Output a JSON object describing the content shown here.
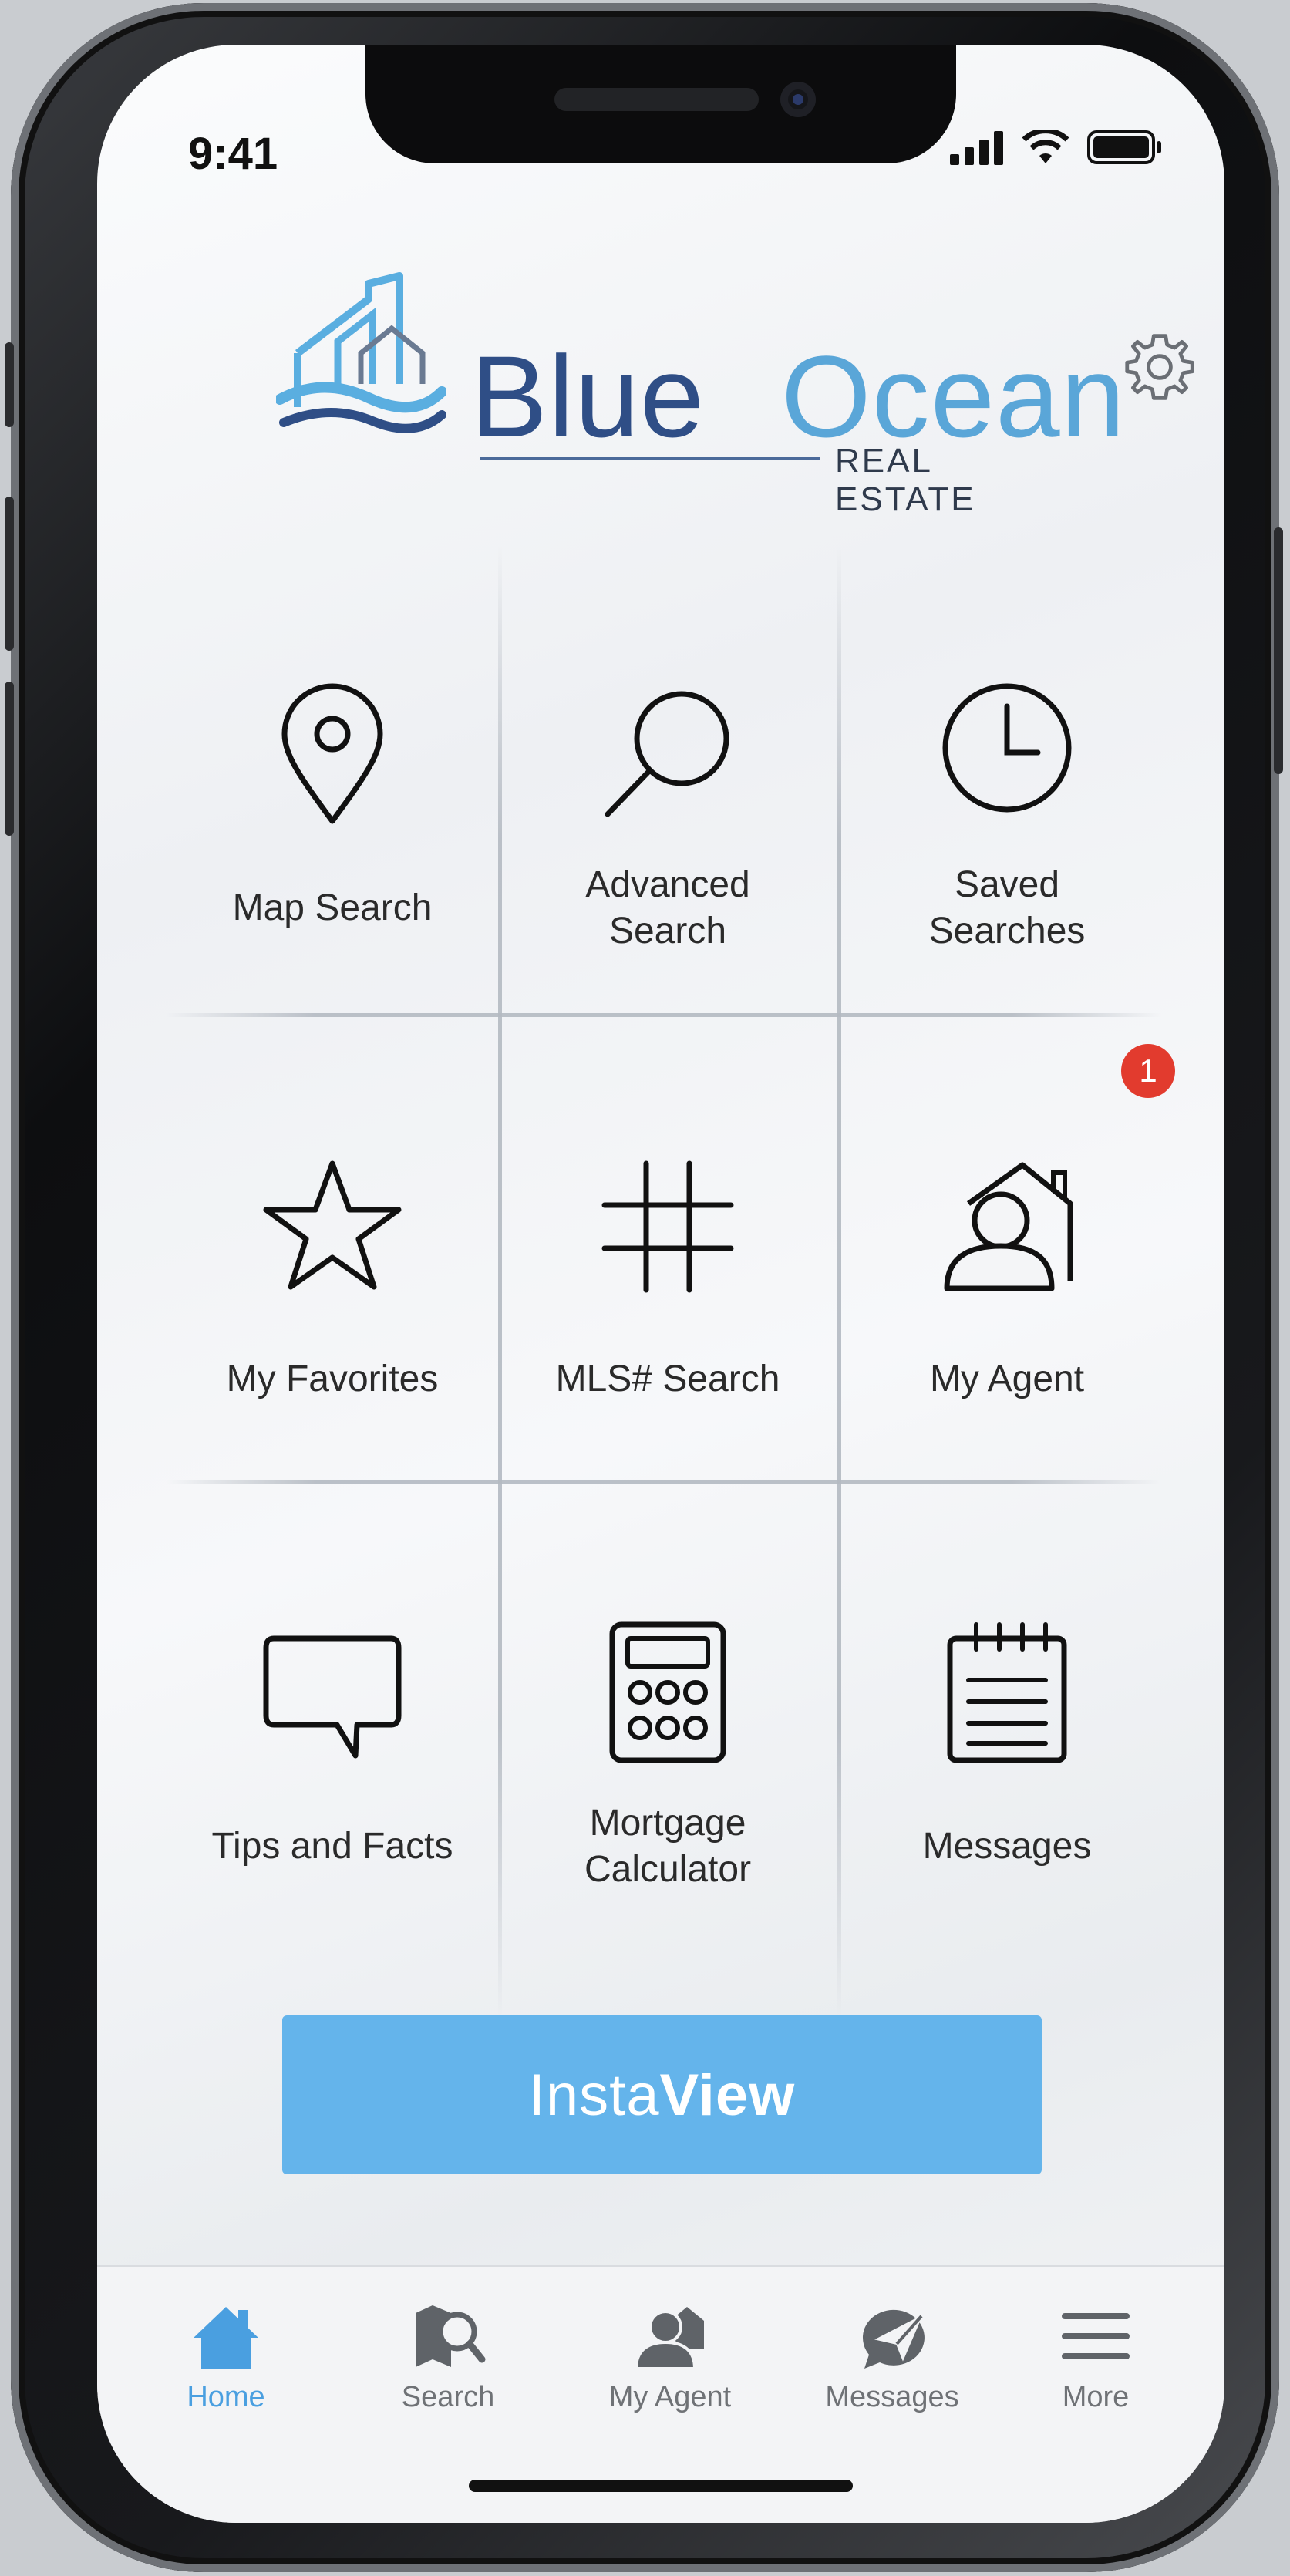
{
  "status": {
    "time": "9:41"
  },
  "brand": {
    "word1": "Blue",
    "word2": "Ocean",
    "sub": "REAL ESTATE"
  },
  "tiles": [
    {
      "label": "Map Search",
      "icon": "map-pin-icon"
    },
    {
      "label": "Advanced Search",
      "icon": "magnifier-icon"
    },
    {
      "label": "Saved Searches",
      "icon": "clock-icon"
    },
    {
      "label": "My Favorites",
      "icon": "star-icon"
    },
    {
      "label": "MLS# Search",
      "icon": "hashtag-icon"
    },
    {
      "label": "My Agent",
      "icon": "agent-house-icon"
    },
    {
      "label": "Tips and Facts",
      "icon": "speech-bubble-icon"
    },
    {
      "label": "Mortgage Calculator",
      "icon": "calculator-icon"
    },
    {
      "label": "Messages",
      "icon": "notepad-icon"
    }
  ],
  "badge": {
    "count": "1"
  },
  "instaview": {
    "part1": "Insta",
    "part2": "View"
  },
  "tabs": [
    {
      "label": "Home",
      "icon": "home-icon",
      "active": true
    },
    {
      "label": "Search",
      "icon": "map-search-icon"
    },
    {
      "label": "My Agent",
      "icon": "agent-icon"
    },
    {
      "label": "Messages",
      "icon": "messages-icon"
    },
    {
      "label": "More",
      "icon": "hamburger-icon"
    }
  ],
  "colors": {
    "accent": "#64b4eb",
    "brand_dark": "#2f4e86",
    "brand_light": "#5aa6d8",
    "badge": "#e23b2e"
  }
}
